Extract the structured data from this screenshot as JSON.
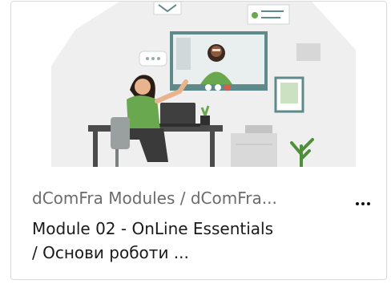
{
  "card": {
    "path": "dComFra Modules / dComFra...",
    "title_line1": "Module 02 - OnLine Essentials",
    "title_line2": "/ Основи роботи ...",
    "thumbnail_icon": "video-call-illustration",
    "more_icon": "more-horizontal-icon"
  },
  "colors": {
    "path_text": "#6b6b6b",
    "title_text": "#1a1a1a",
    "border": "#d9d9d9",
    "illustration_bg": "#efefef",
    "accent_green": "#6aa84f",
    "screen_teal": "#5f8a8b"
  }
}
